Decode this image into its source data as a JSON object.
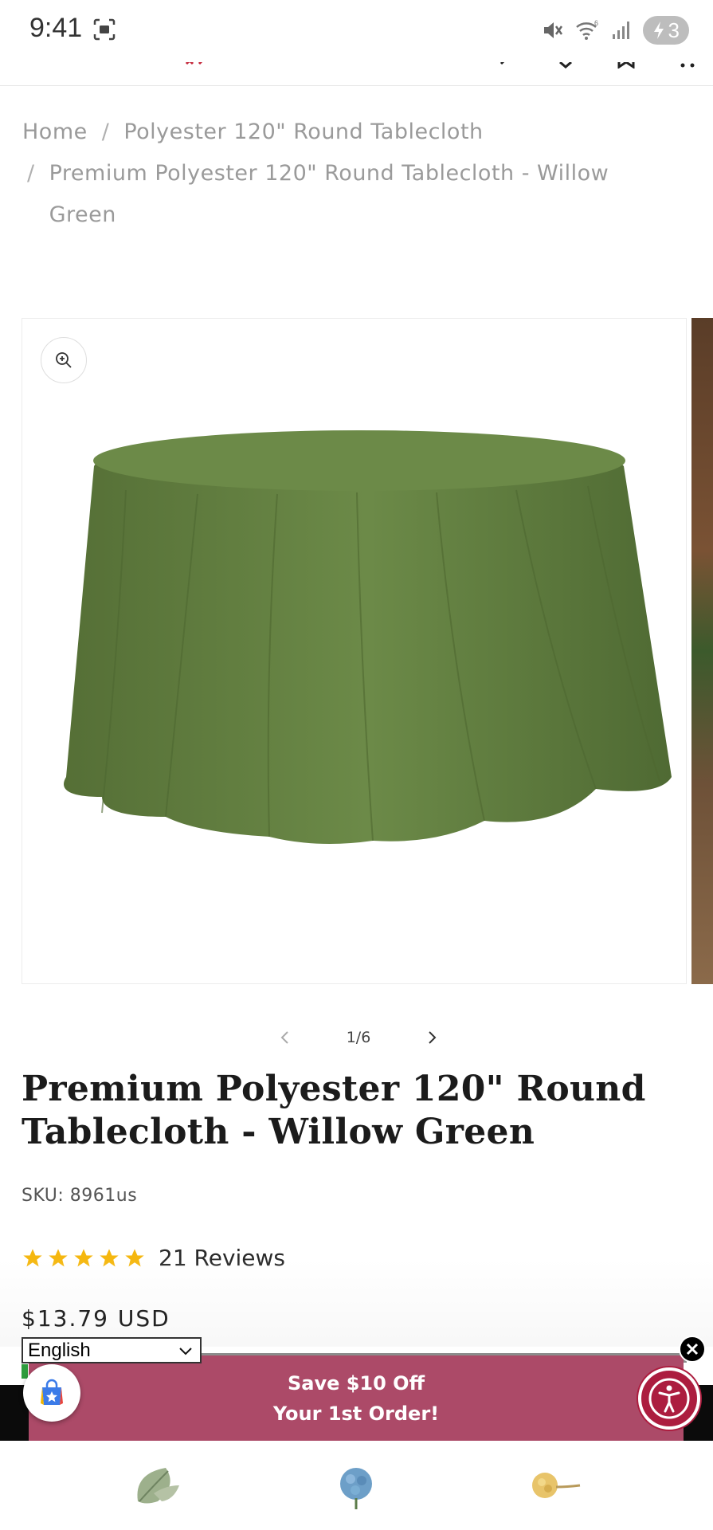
{
  "status_bar": {
    "time": "9:41",
    "battery_level": "3",
    "icons": [
      "screen-record-icon",
      "mute-icon",
      "wifi-icon",
      "signal-icon",
      "battery-charging-icon"
    ]
  },
  "header": {
    "icons": [
      "menu-icon",
      "logo",
      "search-icon",
      "account-icon",
      "wishlist-icon",
      "cart-icon"
    ]
  },
  "breadcrumb": {
    "separator": "/",
    "items": [
      "Home",
      "Polyester 120\" Round Tablecloth",
      "Premium Polyester 120\" Round Tablecloth - Willow Green"
    ]
  },
  "gallery": {
    "zoom_icon": "zoom-in-icon",
    "current": 1,
    "total": 6,
    "counter_text": "1/6",
    "product_color": "#6b8a4a"
  },
  "product": {
    "title": "Premium Polyester 120\" Round Tablecloth - Willow Green",
    "sku": "SKU: 8961us",
    "rating": 5,
    "rating_max": 5,
    "reviews": "21 Reviews",
    "price": "$13.79 USD",
    "star_color": "#f5b70f"
  },
  "language": {
    "selected": "English"
  },
  "promo": {
    "line1": "Save $10 Off",
    "line2": "Your 1st Order!",
    "background": "#ac4a68"
  },
  "accessibility": {
    "icon": "accessibility-icon",
    "color": "#ac1d3f"
  },
  "swatches": {
    "icons": [
      "sage-leaf-swatch",
      "blue-flower-swatch",
      "yellow-flower-swatch"
    ]
  }
}
